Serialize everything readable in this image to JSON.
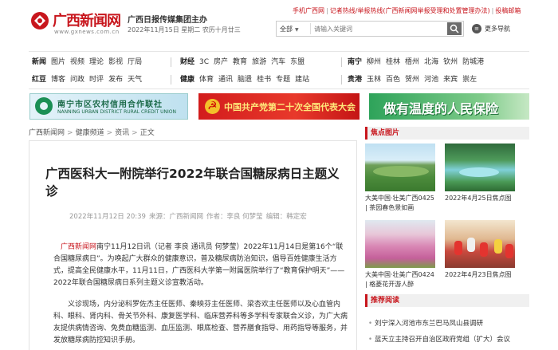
{
  "header": {
    "logo_text": "广西新闻网",
    "logo_url": "www.gxnews.com.cn",
    "sponsor": "广西日报传媒集团主办",
    "date": "2022年11月15日",
    "weekday": "星期二",
    "lunar": "农历十月廿三",
    "top_links": [
      "手机广西网",
      "记者热线/举报热线(广西新闻网举报受理和处置管理办法)",
      "投稿邮箱"
    ],
    "search_scope": "全部",
    "search_placeholder": "请输入关键词",
    "more_nav": "更多导航"
  },
  "nav": {
    "row1": {
      "g1": [
        "新闻",
        "图片",
        "视频",
        "理论",
        "影视",
        "厅局"
      ],
      "g2": [
        "财经",
        "3C",
        "房产",
        "教育",
        "旅游",
        "汽车",
        "东盟"
      ],
      "g3": [
        "南宁",
        "柳州",
        "桂林",
        "梧州",
        "北海",
        "钦州",
        "防城港"
      ]
    },
    "row2": {
      "g1": [
        "红豆",
        "博客",
        "问政",
        "时评",
        "发布",
        "天气"
      ],
      "g2": [
        "健康",
        "体育",
        "通讯",
        "脑遗",
        "桂书",
        "专题",
        "建站"
      ],
      "g3": [
        "贵港",
        "玉林",
        "百色",
        "贺州",
        "河池",
        "来宾",
        "崇左"
      ]
    }
  },
  "banners": {
    "b1_title": "南宁市区农村信用合作联社",
    "b1_sub": "NANNING URBAN DISTRICT RURAL CREDIT UNION",
    "b2_title": "中国共产党第二十次全国代表大会",
    "b3_title": "做有温度的人民保险"
  },
  "breadcrumb": [
    "广西新闻网",
    "健康频道",
    "资讯",
    "正文"
  ],
  "article": {
    "title": "广西医科大一附院举行2022年联合国糖尿病日主题义诊",
    "meta_time": "2022年11月12日 20:39",
    "meta_source": "来源：广西新闻网",
    "meta_author": "作者：李良 何梦莹",
    "meta_editor": "编辑：韩定宏",
    "p1_source": "广西新闻网",
    "p1_text": "南宁11月12日讯（记者 李良 通讯员 何梦莹）2022年11月14日是第16个“联合国糖尿病日”。为唤起广大群众的健康意识，普及糖尿病防治知识，倡导百姓健康生活方式，提高全民健康水平，11月11日，广西医科大学第一附属医院举行了“教育保护明天”——2022年联合国糖尿病日系列主题义诊宣教活动。",
    "p2_text": "义诊现场，内分泌科罗佐杰主任医师、秦映芬主任医师、梁杏欢主任医师以及心血管内科、眼科、肾内科、骨关节外科、康复医学科、临床营养科等多学科专家联合义诊，为广大病友提供病情咨询、免费血糖监测、血压监测、眼底检查、营养膳食指导、用药指导等服务，并发放糖尿病防控知识手册。"
  },
  "sidebar": {
    "photos_heading": "焦点图片",
    "photos": [
      {
        "caption": "大美中国·壮美广西0425 | 茶园春色景如画"
      },
      {
        "caption": "2022年4月25日焦点图"
      },
      {
        "caption": "大美中国·壮美广西0424 | 格菱花开游人醉"
      },
      {
        "caption": "2022年4月23日焦点图"
      }
    ],
    "recommend_heading": "推荐阅读",
    "recommend": [
      "刘宁深入河池市东兰巴马凤山县调研",
      "蓝天立主持召开自治区政府党组（扩大）会议"
    ]
  },
  "colors": {
    "brand_red": "#c8161d",
    "text": "#333333",
    "meta_gray": "#999999"
  }
}
